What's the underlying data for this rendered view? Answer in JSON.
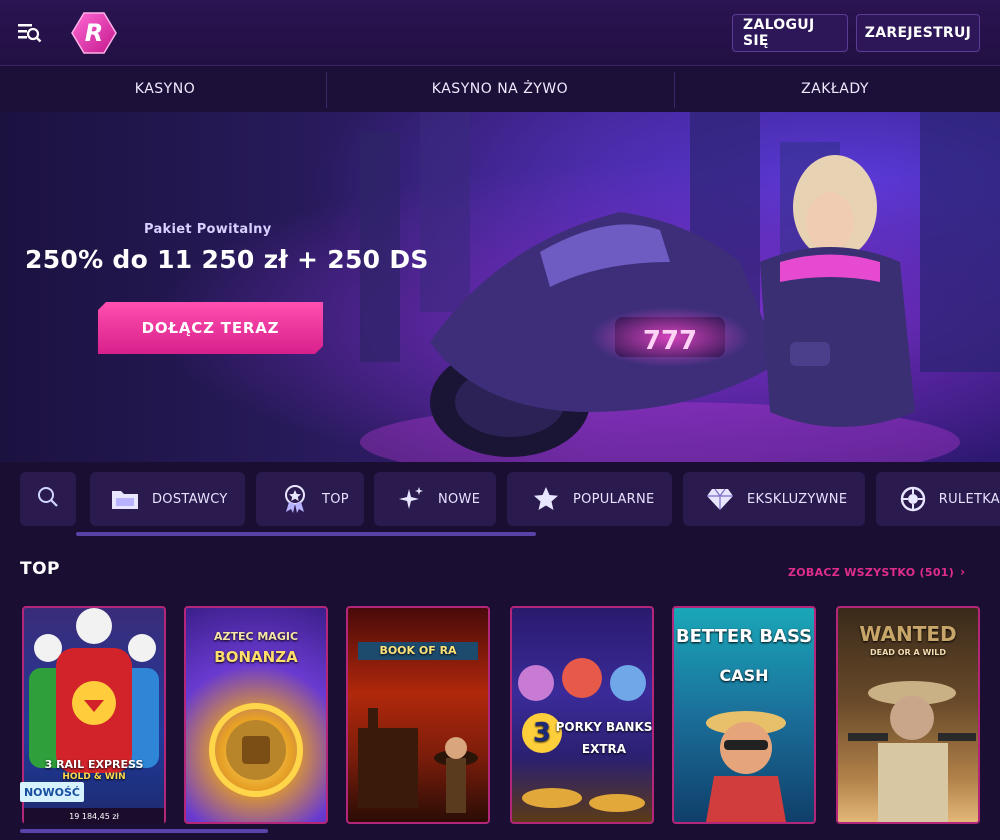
{
  "header": {
    "login_label": "ZALOGUJ SIĘ",
    "register_label": "ZAREJESTRUJ",
    "logo_letter": "R",
    "icons": {
      "menu": "menu-search-icon",
      "logo": "hexagon-logo-icon"
    }
  },
  "nav": {
    "tabs": [
      "KASYNO",
      "KASYNO NA ŻYWO",
      "ZAKŁADY"
    ]
  },
  "hero": {
    "subtitle": "Pakiet Powitalny",
    "title": "250% do 11 250 zł + 250 DS",
    "cta_label": "DOŁĄCZ TERAZ",
    "art_label": "777"
  },
  "categories": {
    "items": [
      {
        "label": "",
        "icon": "search-icon"
      },
      {
        "label": "DOSTAWCY",
        "icon": "folder-icon"
      },
      {
        "label": "TOP",
        "icon": "medal-icon"
      },
      {
        "label": "NOWE",
        "icon": "sparkle-icon"
      },
      {
        "label": "POPULARNE",
        "icon": "star-icon"
      },
      {
        "label": "EKSKLUZYWNE",
        "icon": "diamond-icon"
      },
      {
        "label": "RULETKA",
        "icon": "roulette-icon"
      }
    ]
  },
  "top_section": {
    "title": "TOP",
    "see_all": "ZOBACZ WSZYSTKO (501)",
    "games": [
      {
        "title": "3 RAIL EXPRESS",
        "subtitle": "HOLD & WIN",
        "badge": "NOWOŚĆ",
        "jackpot": "19 184,45 zł"
      },
      {
        "title": "AZTEC MAGIC",
        "subtitle": "BONANZA"
      },
      {
        "title": "BOOK OF RA"
      },
      {
        "title": "PORKY BANKS",
        "subtitle": "EXTRA",
        "number": "3"
      },
      {
        "title": "BETTER BASS",
        "subtitle": "CASH"
      },
      {
        "title": "WANTED",
        "subtitle": "DEAD OR A WILD"
      }
    ]
  },
  "colors": {
    "background": "#1a0f33",
    "accent_pink": "#e02d8c",
    "header": "#2a1452"
  }
}
